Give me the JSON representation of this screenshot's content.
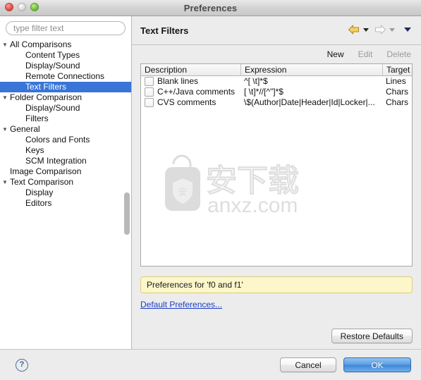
{
  "window": {
    "title": "Preferences",
    "traffic_lights": [
      "close-button",
      "minimize-button",
      "zoom-button"
    ]
  },
  "sidebar": {
    "filter": {
      "value": "",
      "placeholder": "type filter text"
    },
    "items": [
      {
        "label": "All Comparisons",
        "level": 0,
        "twisty": "▼",
        "selected": false
      },
      {
        "label": "Content Types",
        "level": 1,
        "twisty": "",
        "selected": false
      },
      {
        "label": "Display/Sound",
        "level": 1,
        "twisty": "",
        "selected": false
      },
      {
        "label": "Remote Connections",
        "level": 1,
        "twisty": "",
        "selected": false
      },
      {
        "label": "Text Filters",
        "level": 1,
        "twisty": "",
        "selected": true
      },
      {
        "label": "Folder Comparison",
        "level": 0,
        "twisty": "▼",
        "selected": false
      },
      {
        "label": "Display/Sound",
        "level": 1,
        "twisty": "",
        "selected": false
      },
      {
        "label": "Filters",
        "level": 1,
        "twisty": "",
        "selected": false
      },
      {
        "label": "General",
        "level": 0,
        "twisty": "▼",
        "selected": false
      },
      {
        "label": "Colors and Fonts",
        "level": 1,
        "twisty": "",
        "selected": false
      },
      {
        "label": "Keys",
        "level": 1,
        "twisty": "",
        "selected": false
      },
      {
        "label": "SCM Integration",
        "level": 1,
        "twisty": "",
        "selected": false
      },
      {
        "label": "Image Comparison",
        "level": 0,
        "twisty": "",
        "selected": false
      },
      {
        "label": "Text Comparison",
        "level": 0,
        "twisty": "▼",
        "selected": false
      },
      {
        "label": "Display",
        "level": 1,
        "twisty": "",
        "selected": false
      },
      {
        "label": "Editors",
        "level": 1,
        "twisty": "",
        "selected": false
      }
    ]
  },
  "page": {
    "title": "Text Filters",
    "nav": {
      "back_label": "Back",
      "back_menu_label": "Back history",
      "forward_label": "Forward",
      "forward_menu_label": "Forward history",
      "menu_label": "View menu"
    }
  },
  "actions": [
    {
      "label": "New",
      "enabled": true
    },
    {
      "label": "Edit",
      "enabled": false
    },
    {
      "label": "Delete",
      "enabled": false
    }
  ],
  "table": {
    "columns": [
      "Description",
      "Expression",
      "Target"
    ],
    "rows": [
      {
        "checked": false,
        "description": "Blank lines",
        "expression": "^[ \\t]*$",
        "target": "Lines"
      },
      {
        "checked": false,
        "description": "C++/Java comments",
        "expression": "[ \\t]*//[^\"]*$",
        "target": "Chars"
      },
      {
        "checked": false,
        "description": "CVS comments",
        "expression": "\\$(Author|Date|Header|Id|Locker|...",
        "target": "Chars"
      }
    ]
  },
  "status": {
    "text": "Preferences for 'f0 and f1'"
  },
  "links": {
    "default_preferences": "Default Preferences..."
  },
  "buttons": {
    "restore_defaults": "Restore Defaults",
    "cancel": "Cancel",
    "ok": "OK",
    "help": "?"
  },
  "watermark": {
    "cn_text": "安下载",
    "domain": "anxz.com"
  },
  "colors": {
    "selection_blue": "#3875d7",
    "status_yellow": "#fcf6ca",
    "link_blue": "#1a3ec8",
    "ok_blue": "#3d86d6",
    "back_arrow_gold": "#e8b93a"
  }
}
